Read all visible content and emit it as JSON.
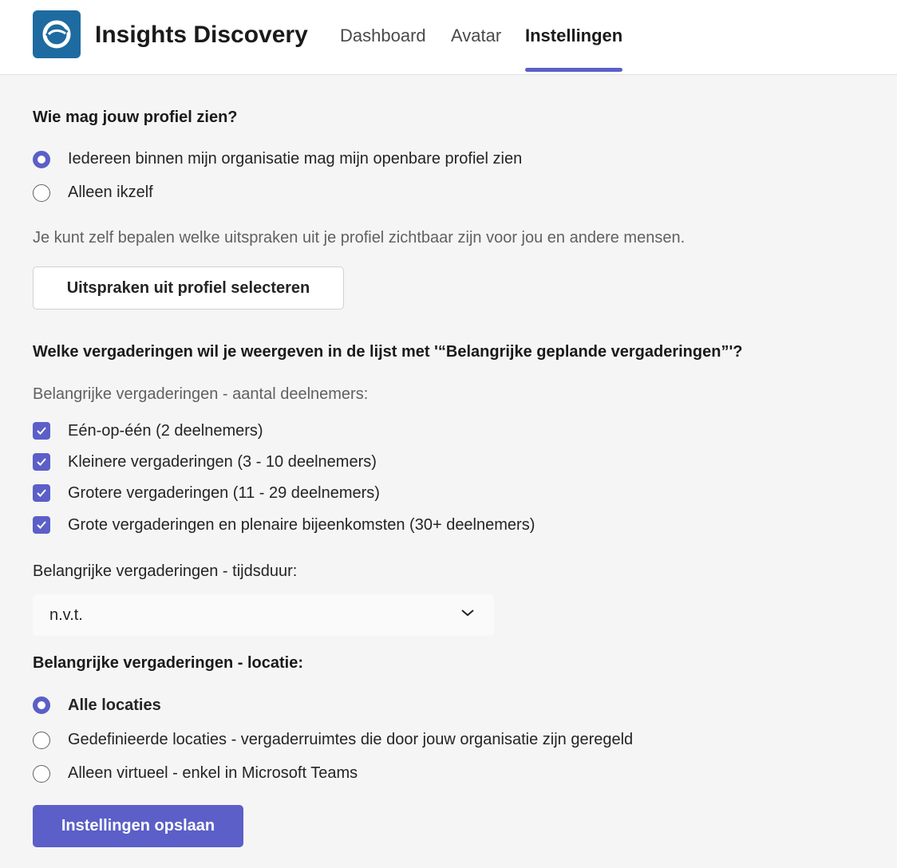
{
  "header": {
    "app_title": "Insights Discovery",
    "tabs": [
      {
        "label": "Dashboard"
      },
      {
        "label": "Avatar"
      },
      {
        "label": "Instellingen"
      }
    ]
  },
  "profile": {
    "heading": "Wie mag jouw profiel zien?",
    "options": [
      {
        "label": "Iedereen binnen mijn organisatie mag mijn openbare profiel zien",
        "selected": true
      },
      {
        "label": "Alleen ikzelf",
        "selected": false
      }
    ],
    "hint": "Je kunt zelf bepalen welke uitspraken uit je profiel zichtbaar zijn voor jou en andere mensen.",
    "select_statements_label": "Uitspraken uit profiel selecteren"
  },
  "meetings": {
    "heading": "Welke vergaderingen wil je weergeven in de lijst met '“Belangrijke geplande vergaderingen”'?",
    "participants_label": "Belangrijke vergaderingen - aantal deelnemers:",
    "participants_options": [
      {
        "label": "Eén-op-één (2 deelnemers)",
        "checked": true
      },
      {
        "label": "Kleinere vergaderingen (3 - 10 deelnemers)",
        "checked": true
      },
      {
        "label": "Grotere vergaderingen (11 - 29 deelnemers)",
        "checked": true
      },
      {
        "label": "Grote vergaderingen en plenaire bijeenkomsten (30+ deelnemers)",
        "checked": true
      }
    ],
    "duration_label": "Belangrijke vergaderingen - tijdsduur:",
    "duration_value": "n.v.t.",
    "location_label": "Belangrijke vergaderingen - locatie:",
    "location_options": [
      {
        "label": "Alle locaties",
        "selected": true
      },
      {
        "label": "Gedefinieerde locaties - vergaderruimtes die door jouw organisatie zijn geregeld",
        "selected": false
      },
      {
        "label": "Alleen virtueel - enkel in Microsoft Teams",
        "selected": false
      }
    ]
  },
  "save_label": "Instellingen opslaan",
  "colors": {
    "accent": "#5b5fc7",
    "logo": "#1d6ba0",
    "background": "#f5f5f5"
  }
}
